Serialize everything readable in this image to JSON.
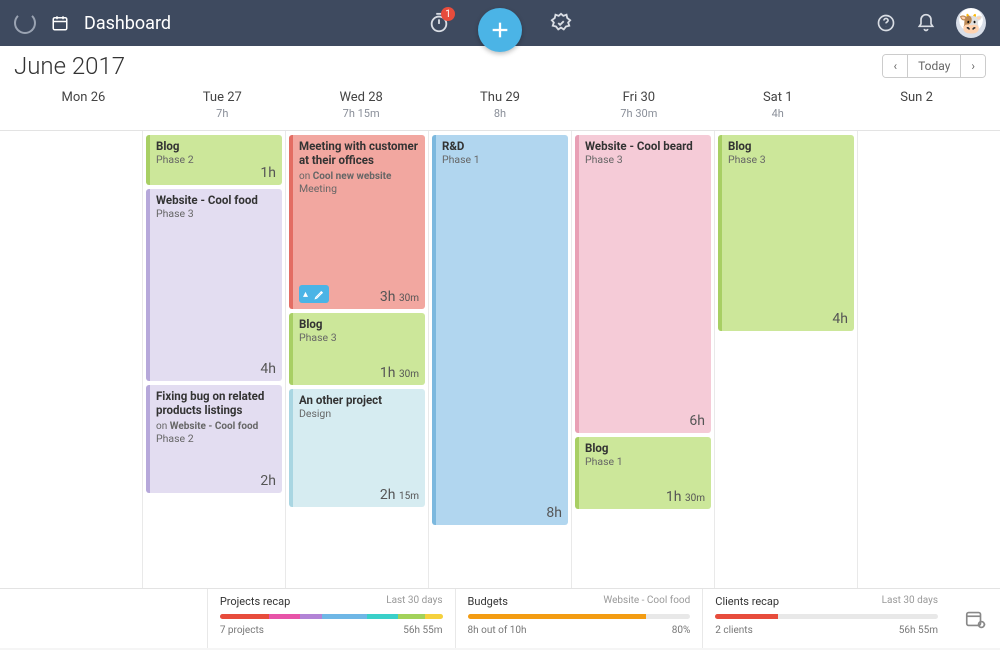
{
  "header": {
    "title": "Dashboard",
    "badge": "1"
  },
  "month": "June 2017",
  "today_label": "Today",
  "days": [
    {
      "label": "Mon 26",
      "hours": ""
    },
    {
      "label": "Tue 27",
      "hours": "7h"
    },
    {
      "label": "Wed 28",
      "hours": "7h 15m"
    },
    {
      "label": "Thu 29",
      "hours": "8h"
    },
    {
      "label": "Fri 30",
      "hours": "7h 30m"
    },
    {
      "label": "Sat 1",
      "hours": "4h"
    },
    {
      "label": "Sun 2",
      "hours": ""
    }
  ],
  "cards": {
    "tue": [
      {
        "title": "Blog",
        "sub": "Phase 2",
        "dur": "1h"
      },
      {
        "title": "Website - Cool food",
        "sub": "Phase 3",
        "dur": "4h"
      },
      {
        "title": "Fixing bug on related products listings",
        "on_prefix": "on ",
        "on": "Website - Cool food",
        "sub2": "Phase 2",
        "dur": "2h"
      }
    ],
    "wed": [
      {
        "title": "Meeting with customer at their offices",
        "on_prefix": "on ",
        "on": "Cool new website",
        "sub2": "Meeting",
        "dur": "3h",
        "dur_m": "30m"
      },
      {
        "title": "Blog",
        "sub": "Phase 3",
        "dur": "1h",
        "dur_m": "30m"
      },
      {
        "title": "An other project",
        "sub": "Design",
        "dur": "2h",
        "dur_m": "15m"
      }
    ],
    "thu": [
      {
        "title": "R&D",
        "sub": "Phase 1",
        "dur": "8h"
      }
    ],
    "fri": [
      {
        "title": "Website - Cool beard",
        "sub": "Phase 3",
        "dur": "6h"
      },
      {
        "title": "Blog",
        "sub": "Phase 1",
        "dur": "1h",
        "dur_m": "30m"
      }
    ],
    "sat": [
      {
        "title": "Blog",
        "sub": "Phase 3",
        "dur": "4h"
      }
    ]
  },
  "footer": {
    "projects": {
      "title": "Projects recap",
      "meta": "Last 30 days",
      "left": "7 projects",
      "right": "56h 55m"
    },
    "budgets": {
      "title": "Budgets",
      "meta": "Website - Cool food",
      "left": "8h out of 10h",
      "right": "80%"
    },
    "clients": {
      "title": "Clients recap",
      "meta": "Last 30 days",
      "left": "2 clients",
      "right": "56h 55m"
    }
  }
}
